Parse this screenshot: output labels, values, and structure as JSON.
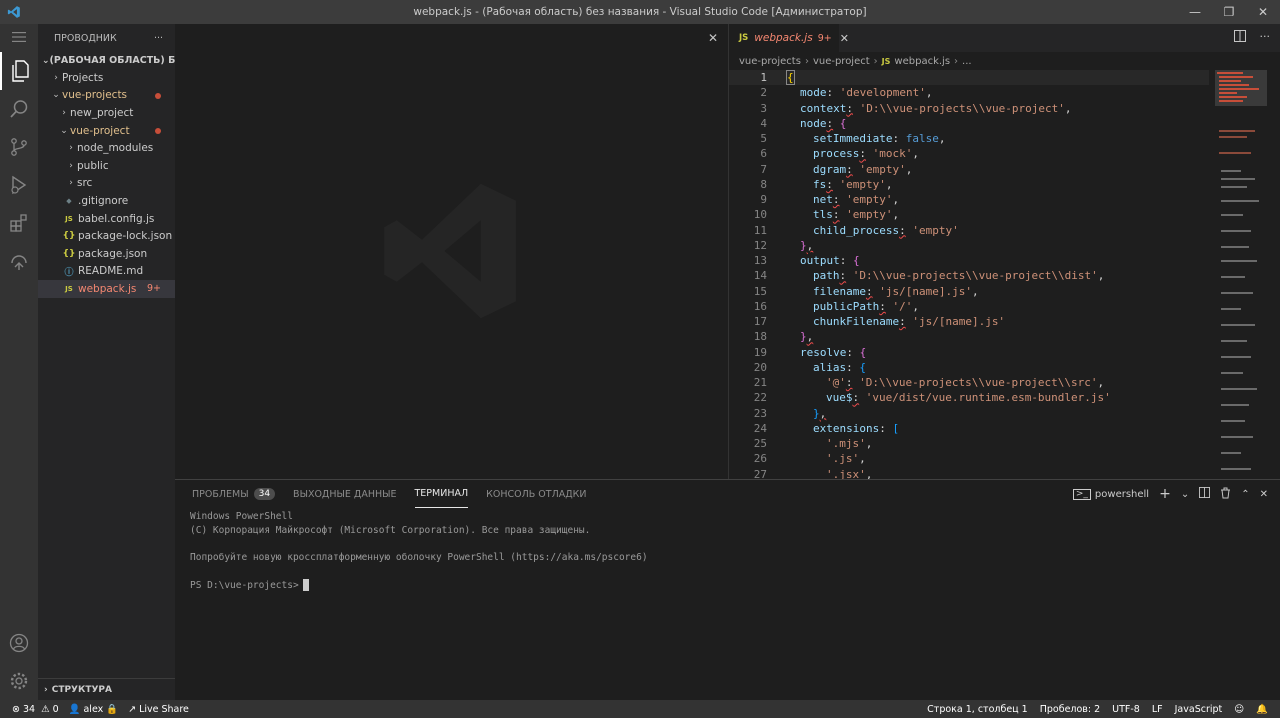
{
  "window": {
    "title": "webpack.js - (Рабочая область) без названия - Visual Studio Code [Администратор]",
    "minimize": "—",
    "maximize": "❐",
    "close": "✕"
  },
  "sidebar": {
    "header": "ПРОВОДНИК",
    "more": "···",
    "workspace": "(РАБОЧАЯ ОБЛАСТЬ) Б...",
    "items": [
      {
        "label": "Projects",
        "chev": "›",
        "icon": ""
      },
      {
        "label": "vue-projects",
        "chev": "⌄",
        "icon": ""
      },
      {
        "label": "new_project",
        "chev": "›",
        "icon": ""
      },
      {
        "label": "vue-project",
        "chev": "⌄",
        "icon": ""
      },
      {
        "label": "node_modules",
        "chev": "›",
        "icon": ""
      },
      {
        "label": "public",
        "chev": "›",
        "icon": ""
      },
      {
        "label": "src",
        "chev": "›",
        "icon": ""
      },
      {
        "label": ".gitignore",
        "chev": "",
        "icon": "◆"
      },
      {
        "label": "babel.config.js",
        "chev": "",
        "icon": "JS"
      },
      {
        "label": "package-lock.json",
        "chev": "",
        "icon": "{}"
      },
      {
        "label": "package.json",
        "chev": "",
        "icon": "{}"
      },
      {
        "label": "README.md",
        "chev": "",
        "icon": "ⓘ"
      },
      {
        "label": "webpack.js",
        "chev": "",
        "icon": "JS",
        "badge": "9+"
      }
    ],
    "outline": "СТРУКТУРА"
  },
  "editor": {
    "tab": {
      "icon": "JS",
      "name": "webpack.js",
      "count": "9+",
      "close": "✕"
    },
    "breadcrumb": [
      "vue-projects",
      "vue-project",
      "webpack.js",
      "..."
    ],
    "breadcrumb_js": "JS",
    "line_numbers": [
      "1",
      "2",
      "3",
      "4",
      "5",
      "6",
      "7",
      "8",
      "9",
      "10",
      "11",
      "12",
      "13",
      "14",
      "15",
      "16",
      "17",
      "18",
      "19",
      "20",
      "21",
      "22",
      "23",
      "24",
      "25",
      "26",
      "27"
    ],
    "code": {
      "l2_key": "mode",
      "l2_val": "'development'",
      "l3_key": "context",
      "l3_val": "'D:\\\\vue-projects\\\\vue-project'",
      "l4_key": "node",
      "l5_key": "setImmediate",
      "l5_val": "false",
      "l6_key": "process",
      "l6_val": "'mock'",
      "l7_key": "dgram",
      "l7_val": "'empty'",
      "l8_key": "fs",
      "l8_val": "'empty'",
      "l9_key": "net",
      "l9_val": "'empty'",
      "l10_key": "tls",
      "l10_val": "'empty'",
      "l11_key": "child_process",
      "l11_val": "'empty'",
      "l13_key": "output",
      "l14_key": "path",
      "l14_val": "'D:\\\\vue-projects\\\\vue-project\\\\dist'",
      "l15_key": "filename",
      "l15_val": "'js/[name].js'",
      "l16_key": "publicPath",
      "l16_val": "'/'",
      "l17_key": "chunkFilename",
      "l17_val": "'js/[name].js'",
      "l19_key": "resolve",
      "l20_key": "alias",
      "l21_key": "'@'",
      "l21_val": "'D:\\\\vue-projects\\\\vue-project\\\\src'",
      "l22_key": "vue$",
      "l22_val": "'vue/dist/vue.runtime.esm-bundler.js'",
      "l24_key": "extensions",
      "l25_val": "'.mjs'",
      "l26_val": "'.js'",
      "l27_val": "'.jsx'"
    }
  },
  "panel": {
    "tabs": [
      "ПРОБЛЕМЫ",
      "ВЫХОДНЫЕ ДАННЫЕ",
      "ТЕРМИНАЛ",
      "КОНСОЛЬ ОТЛАДКИ"
    ],
    "problems_count": "34",
    "shell": "powershell",
    "terminal": [
      "Windows PowerShell",
      "(C) Корпорация Майкрософт (Microsoft Corporation). Все права защищены.",
      "",
      "Попробуйте новую кроссплатформенную оболочку PowerShell (https://aka.ms/pscore6)",
      "",
      "PS D:\\vue-projects>"
    ]
  },
  "statusbar": {
    "errors": "34",
    "warnings": "0",
    "user": "alex",
    "liveshare": "Live Share",
    "position": "Строка 1, столбец 1",
    "spaces": "Пробелов: 2",
    "encoding": "UTF-8",
    "eol": "LF",
    "language": "JavaScript"
  },
  "colors": {
    "accent_error": "#f48771",
    "modified": "#e2c08d",
    "string": "#ce9178",
    "property": "#9cdcfe",
    "keyword": "#569cd6"
  }
}
